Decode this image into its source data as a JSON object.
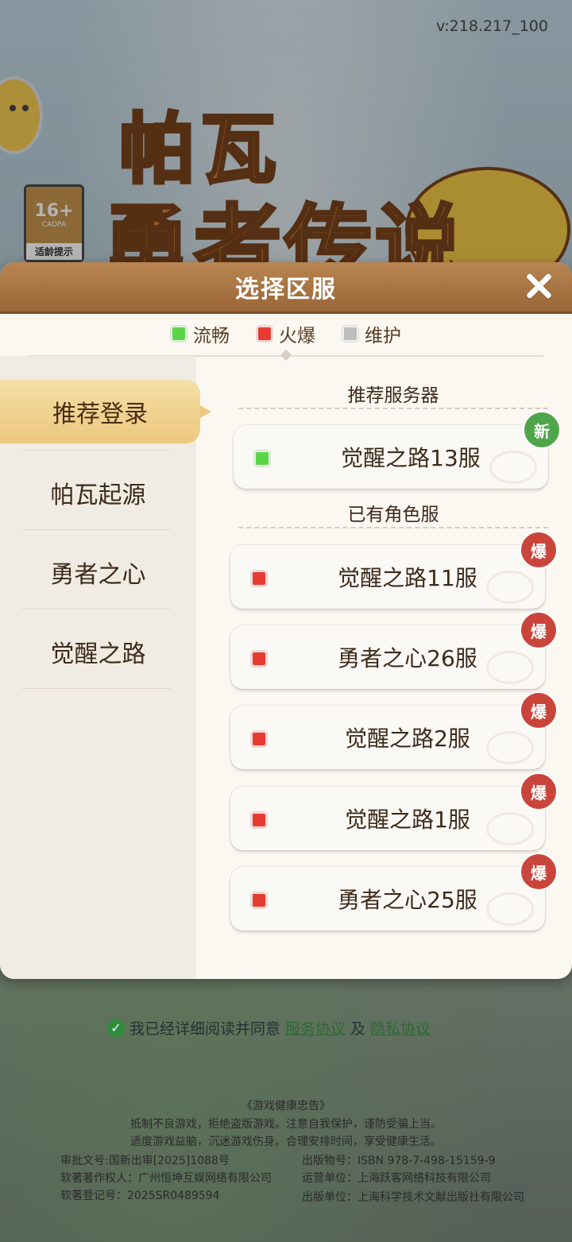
{
  "version": "v:218.217_100",
  "rating": {
    "age": "16+",
    "org": "CADPA",
    "tip": "适龄提示"
  },
  "logo": {
    "line1": "帕瓦",
    "line2": "勇者传说"
  },
  "dialog": {
    "title": "选择区服",
    "legend": [
      {
        "label": "流畅",
        "color": "#5ad548"
      },
      {
        "label": "火爆",
        "color": "#e53b30"
      },
      {
        "label": "维护",
        "color": "#bdbdbd"
      }
    ],
    "sidebar": [
      "推荐登录",
      "帕瓦起源",
      "勇者之心",
      "觉醒之路"
    ],
    "sections": {
      "recommended": "推荐服务器",
      "existing": "已有角色服"
    },
    "recommended": [
      {
        "name": "觉醒之路13服",
        "status_color": "#5ad548",
        "badge": "新"
      }
    ],
    "existing": [
      {
        "name": "觉醒之路11服",
        "status_color": "#e53b30",
        "badge": "爆"
      },
      {
        "name": "勇者之心26服",
        "status_color": "#e53b30",
        "badge": "爆"
      },
      {
        "name": "觉醒之路2服",
        "status_color": "#e53b30",
        "badge": "爆"
      },
      {
        "name": "觉醒之路1服",
        "status_color": "#e53b30",
        "badge": "爆"
      },
      {
        "name": "勇者之心25服",
        "status_color": "#e53b30",
        "badge": "爆"
      }
    ]
  },
  "agreement": {
    "text": "我已经详细阅读并同意",
    "service": "服务协议",
    "and": "及",
    "privacy": "隐私协议"
  },
  "footer": {
    "title": "《游戏健康忠告》",
    "line1": "抵制不良游戏，拒绝盗版游戏。注意自我保护，谨防受骗上当。",
    "line2": "适度游戏益脑，沉迷游戏伤身。合理安排时间，享受健康生活。",
    "approval": "审批文号:国新出审[2025]1088号",
    "isbn": "出版物号：ISBN 978-7-498-15159-9",
    "copyright_owner": "软著著作权人：广州恒坤互娱网络有限公司",
    "operator": "运营单位：上海跃客网络科技有限公司",
    "registration": "软著登记号：2025SR0489594",
    "publisher": "出版单位：上海科学技术文献出版社有限公司"
  }
}
